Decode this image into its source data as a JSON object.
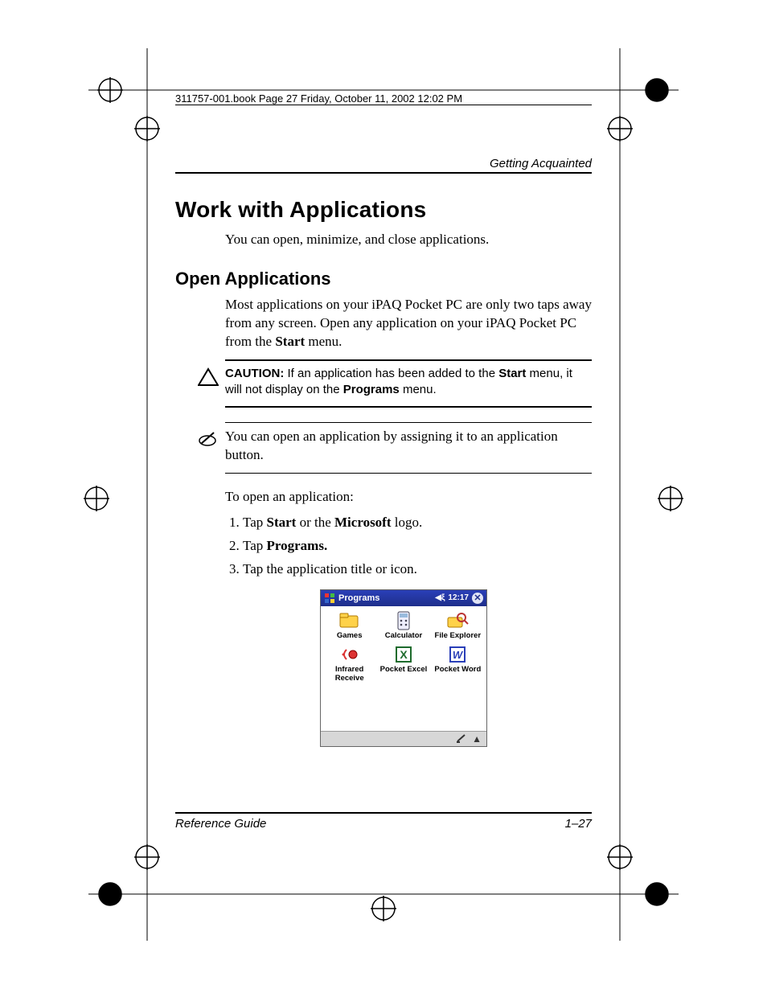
{
  "page_meta": {
    "book_header": "311757-001.book  Page 27  Friday, October 11, 2002  12:02 PM",
    "running_head": "Getting Acquainted",
    "footer_left": "Reference Guide",
    "footer_right": "1–27"
  },
  "headings": {
    "h1": "Work with Applications",
    "h2": "Open Applications"
  },
  "paragraphs": {
    "intro": "You can open, minimize, and close applications.",
    "open_body_pre": "Most applications on your iPAQ Pocket PC are only two taps away from any screen. Open any application on your iPAQ Pocket PC from the ",
    "open_body_bold1": "Start",
    "open_body_post": " menu.",
    "caution_label": "CAUTION:",
    "caution_text_a": " If an application has been added to the ",
    "caution_bold1": "Start",
    "caution_text_b": " menu, it will not display on the ",
    "caution_bold2": "Programs",
    "caution_text_c": " menu.",
    "note_text": "You can open an application by assigning it to an application button.",
    "to_open": "To open an application:"
  },
  "steps": {
    "s1_a": "Tap ",
    "s1_b1": "Start",
    "s1_b": " or the ",
    "s1_b2": "Microsoft",
    "s1_c": " logo.",
    "s2_a": "Tap ",
    "s2_b1": "Programs.",
    "s3": "Tap the application title or icon."
  },
  "device": {
    "title": "Programs",
    "clock": "12:17",
    "apps": [
      {
        "name": "Games"
      },
      {
        "name": "Calculator"
      },
      {
        "name": "File Explorer"
      },
      {
        "name": "Infrared Receive"
      },
      {
        "name": "Pocket Excel"
      },
      {
        "name": "Pocket Word"
      }
    ]
  }
}
